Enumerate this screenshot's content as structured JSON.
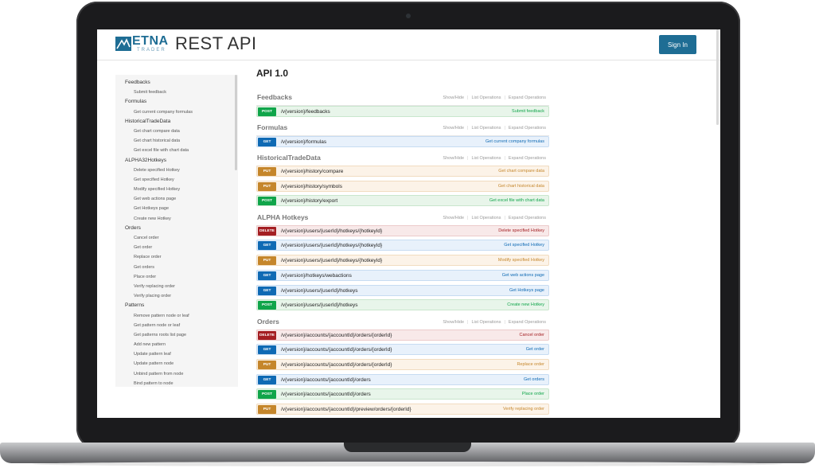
{
  "header": {
    "logo_text": "ETNA",
    "logo_sub": "TRADER",
    "app_title": "REST API",
    "sign_in_label": "Sign In",
    "brand_color": "#1e6d94"
  },
  "sidebar": {
    "groups": [
      {
        "label": "Feedbacks",
        "items": [
          "Submit feedback"
        ]
      },
      {
        "label": "Formulas",
        "items": [
          "Get current company formulas"
        ]
      },
      {
        "label": "HistoricalTradeData",
        "items": [
          "Get chart compare data",
          "Get chart historical data",
          "Get excel file with chart data"
        ]
      },
      {
        "label": "ALPHA32Hotkeys",
        "items": [
          "Delete specified Hotkey",
          "Get specified Hotkey",
          "Modify specified Hotkey",
          "Get web actions page",
          "Get Hotkeys page",
          "Create new Hotkey"
        ]
      },
      {
        "label": "Orders",
        "items": [
          "Cancel order",
          "Get order",
          "Replace order",
          "Get orders",
          "Place order",
          "Verify replacing order",
          "Verify placing order"
        ]
      },
      {
        "label": "Patterns",
        "items": [
          "Remove pattern node or leaf",
          "Get pattern node or leaf",
          "Get patterns roots list page",
          "Add new pattern",
          "Update pattern leaf",
          "Update pattern node",
          "Unbind pattern from node",
          "Bind pattern to node"
        ]
      }
    ]
  },
  "main": {
    "api_title": "API 1.0",
    "section_links": [
      "Show/Hide",
      "List Operations",
      "Expand Operations"
    ],
    "method_colors": {
      "POST": "#10a54a",
      "GET": "#0f6ab4",
      "PUT": "#c5862b",
      "DELETE": "#a41e22"
    },
    "sections": [
      {
        "title": "Feedbacks",
        "operations": [
          {
            "method": "POST",
            "path": "/v{version}/feedbacks",
            "summary": "Submit feedback"
          }
        ]
      },
      {
        "title": "Formulas",
        "operations": [
          {
            "method": "GET",
            "path": "/v{version}/formulas",
            "summary": "Get current company formulas"
          }
        ]
      },
      {
        "title": "HistoricalTradeData",
        "operations": [
          {
            "method": "PUT",
            "path": "/v{version}/history/compare",
            "summary": "Get chart compare data"
          },
          {
            "method": "PUT",
            "path": "/v{version}/history/symbols",
            "summary": "Get chart historical data"
          },
          {
            "method": "POST",
            "path": "/v{version}/history/export",
            "summary": "Get excel file with chart data"
          }
        ]
      },
      {
        "title": "ALPHA Hotkeys",
        "operations": [
          {
            "method": "DELETE",
            "path": "/v{version}/users/{userId}/hotkeys/{hotkeyId}",
            "summary": "Delete specified Hotkey"
          },
          {
            "method": "GET",
            "path": "/v{version}/users/{userId}/hotkeys/{hotkeyId}",
            "summary": "Get specified Hotkey"
          },
          {
            "method": "PUT",
            "path": "/v{version}/users/{userId}/hotkeys/{hotkeyId}",
            "summary": "Modify specified Hotkey"
          },
          {
            "method": "GET",
            "path": "/v{version}/hotkeys/webactions",
            "summary": "Get web actions page"
          },
          {
            "method": "GET",
            "path": "/v{version}/users/{userId}/hotkeys",
            "summary": "Get Hotkeys page"
          },
          {
            "method": "POST",
            "path": "/v{version}/users/{userId}/hotkeys",
            "summary": "Create new Hotkey"
          }
        ]
      },
      {
        "title": "Orders",
        "operations": [
          {
            "method": "DELETE",
            "path": "/v{version}/accounts/{accountId}/orders/{orderId}",
            "summary": "Cancel order"
          },
          {
            "method": "GET",
            "path": "/v{version}/accounts/{accountId}/orders/{orderId}",
            "summary": "Get order"
          },
          {
            "method": "PUT",
            "path": "/v{version}/accounts/{accountId}/orders/{orderId}",
            "summary": "Replace order"
          },
          {
            "method": "GET",
            "path": "/v{version}/accounts/{accountId}/orders",
            "summary": "Get orders"
          },
          {
            "method": "POST",
            "path": "/v{version}/accounts/{accountId}/orders",
            "summary": "Place order"
          },
          {
            "method": "PUT",
            "path": "/v{version}/accounts/{accountId}/preview/orders/{orderId}",
            "summary": "Verify replacing order"
          }
        ]
      }
    ]
  }
}
